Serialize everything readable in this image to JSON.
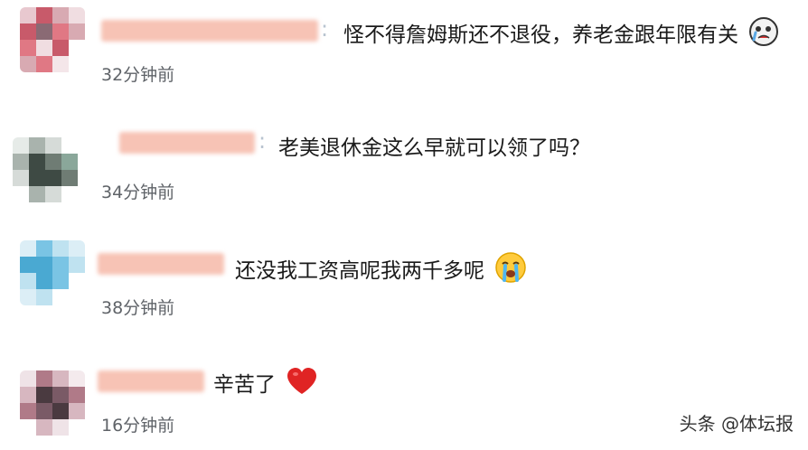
{
  "comments": [
    {
      "text": "怪不得詹姆斯还不退役，养老金跟年限有关",
      "time": "32分钟前",
      "emoji": "crying-face-with-hand-icon",
      "avatar_colors": [
        "#c85a6a",
        "#e07884",
        "#8a6a74",
        "#d8aab2"
      ]
    },
    {
      "text": "老美退休金这么早就可以领了吗？",
      "time": "34分钟前",
      "emoji": "",
      "avatar_colors": [
        "#3e4a44",
        "#6f7c74",
        "#8aa79a",
        "#a9b3ad"
      ]
    },
    {
      "text": "还没我工资高呢我两千多呢",
      "time": "38分钟前",
      "emoji": "sob-emoji-icon",
      "avatar_colors": [
        "#4aa9d2",
        "#7ac4e4",
        "#bfe2f0",
        "#dceef6"
      ]
    },
    {
      "text": "辛苦了",
      "time": "16分钟前",
      "emoji": "red-heart-icon",
      "avatar_colors": [
        "#7a5a66",
        "#b07a88",
        "#4a3a40",
        "#d7b7c0"
      ]
    }
  ],
  "watermark": "头条 @体坛报",
  "colors": {
    "name_blur": "#f7c3b5",
    "time": "#5f6368",
    "heart": "#e02424",
    "emoji_face": "#ffcb3d"
  }
}
